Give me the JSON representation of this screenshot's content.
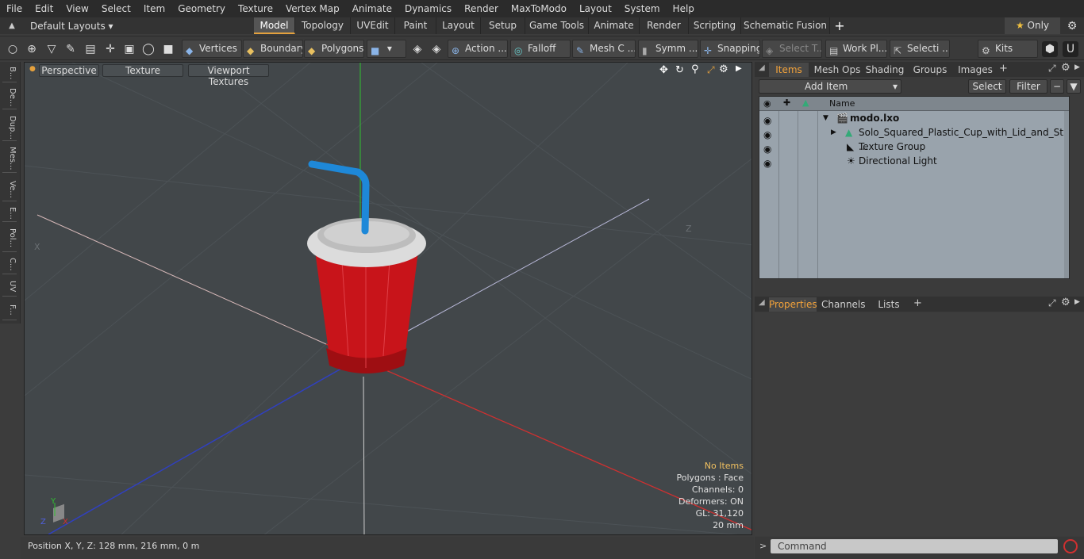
{
  "menu": [
    "File",
    "Edit",
    "View",
    "Select",
    "Item",
    "Geometry",
    "Texture",
    "Vertex Map",
    "Animate",
    "Dynamics",
    "Render",
    "MaxToModo",
    "Layout",
    "System",
    "Help"
  ],
  "layout_dropdown": "Default Layouts",
  "tabs": [
    "Model",
    "Topology",
    "UVEdit",
    "Paint",
    "Layout",
    "Setup",
    "Game Tools",
    "Animate",
    "Render",
    "Scripting",
    "Schematic Fusion"
  ],
  "only_label": "Only",
  "toolbar": {
    "vertices": "Vertices",
    "boundary": "Boundary",
    "polygons": "Polygons",
    "action": "Action",
    "falloff": "Falloff",
    "mesh": "Mesh C ...",
    "symm": "Symm ...",
    "snapping": "Snapping",
    "select_t": "Select T...",
    "work_pl": "Work Pl...",
    "selecti": "Selecti ...",
    "kits": "Kits"
  },
  "left_tabs": [
    "B...",
    "De...",
    "Dup...",
    "Mes...",
    "Ve...",
    "E...",
    "Pol...",
    "C...",
    "UV",
    "F..."
  ],
  "viewport": {
    "perspective": "Perspective",
    "texture": "Texture",
    "viewport_textures": "Viewport Textures",
    "axis_x": "X",
    "axis_z": "Z",
    "gizmo_y": "Y",
    "gizmo_z": "Z",
    "gizmo_x": "X"
  },
  "stats": {
    "no_items": "No Items",
    "polygons": "Polygons : Face",
    "channels": "Channels: 0",
    "deformers": "Deformers: ON",
    "gl": "GL: 31,120",
    "scale": "20 mm"
  },
  "status": "Position X, Y, Z:   128 mm, 216 mm, 0 m",
  "items_panel": {
    "tabs": [
      "Items",
      "Mesh Ops",
      "Shading",
      "Groups",
      "Images"
    ],
    "add_item": "Add Item",
    "select": "Select",
    "filter": "Filter",
    "col_name": "Name",
    "rows": [
      "modo.lxo",
      "Solo_Squared_Plastic_Cup_with_Lid_and_Straw_Re ...",
      "Texture Group",
      "Directional Light"
    ]
  },
  "properties_panel": {
    "tabs": [
      "Properties",
      "Channels",
      "Lists"
    ]
  },
  "command_placeholder": "Command",
  "colors": {
    "accent": "#e3a03d",
    "cup": "#c8141a",
    "straw": "#1e88d8",
    "lid": "#d8d8d8"
  }
}
